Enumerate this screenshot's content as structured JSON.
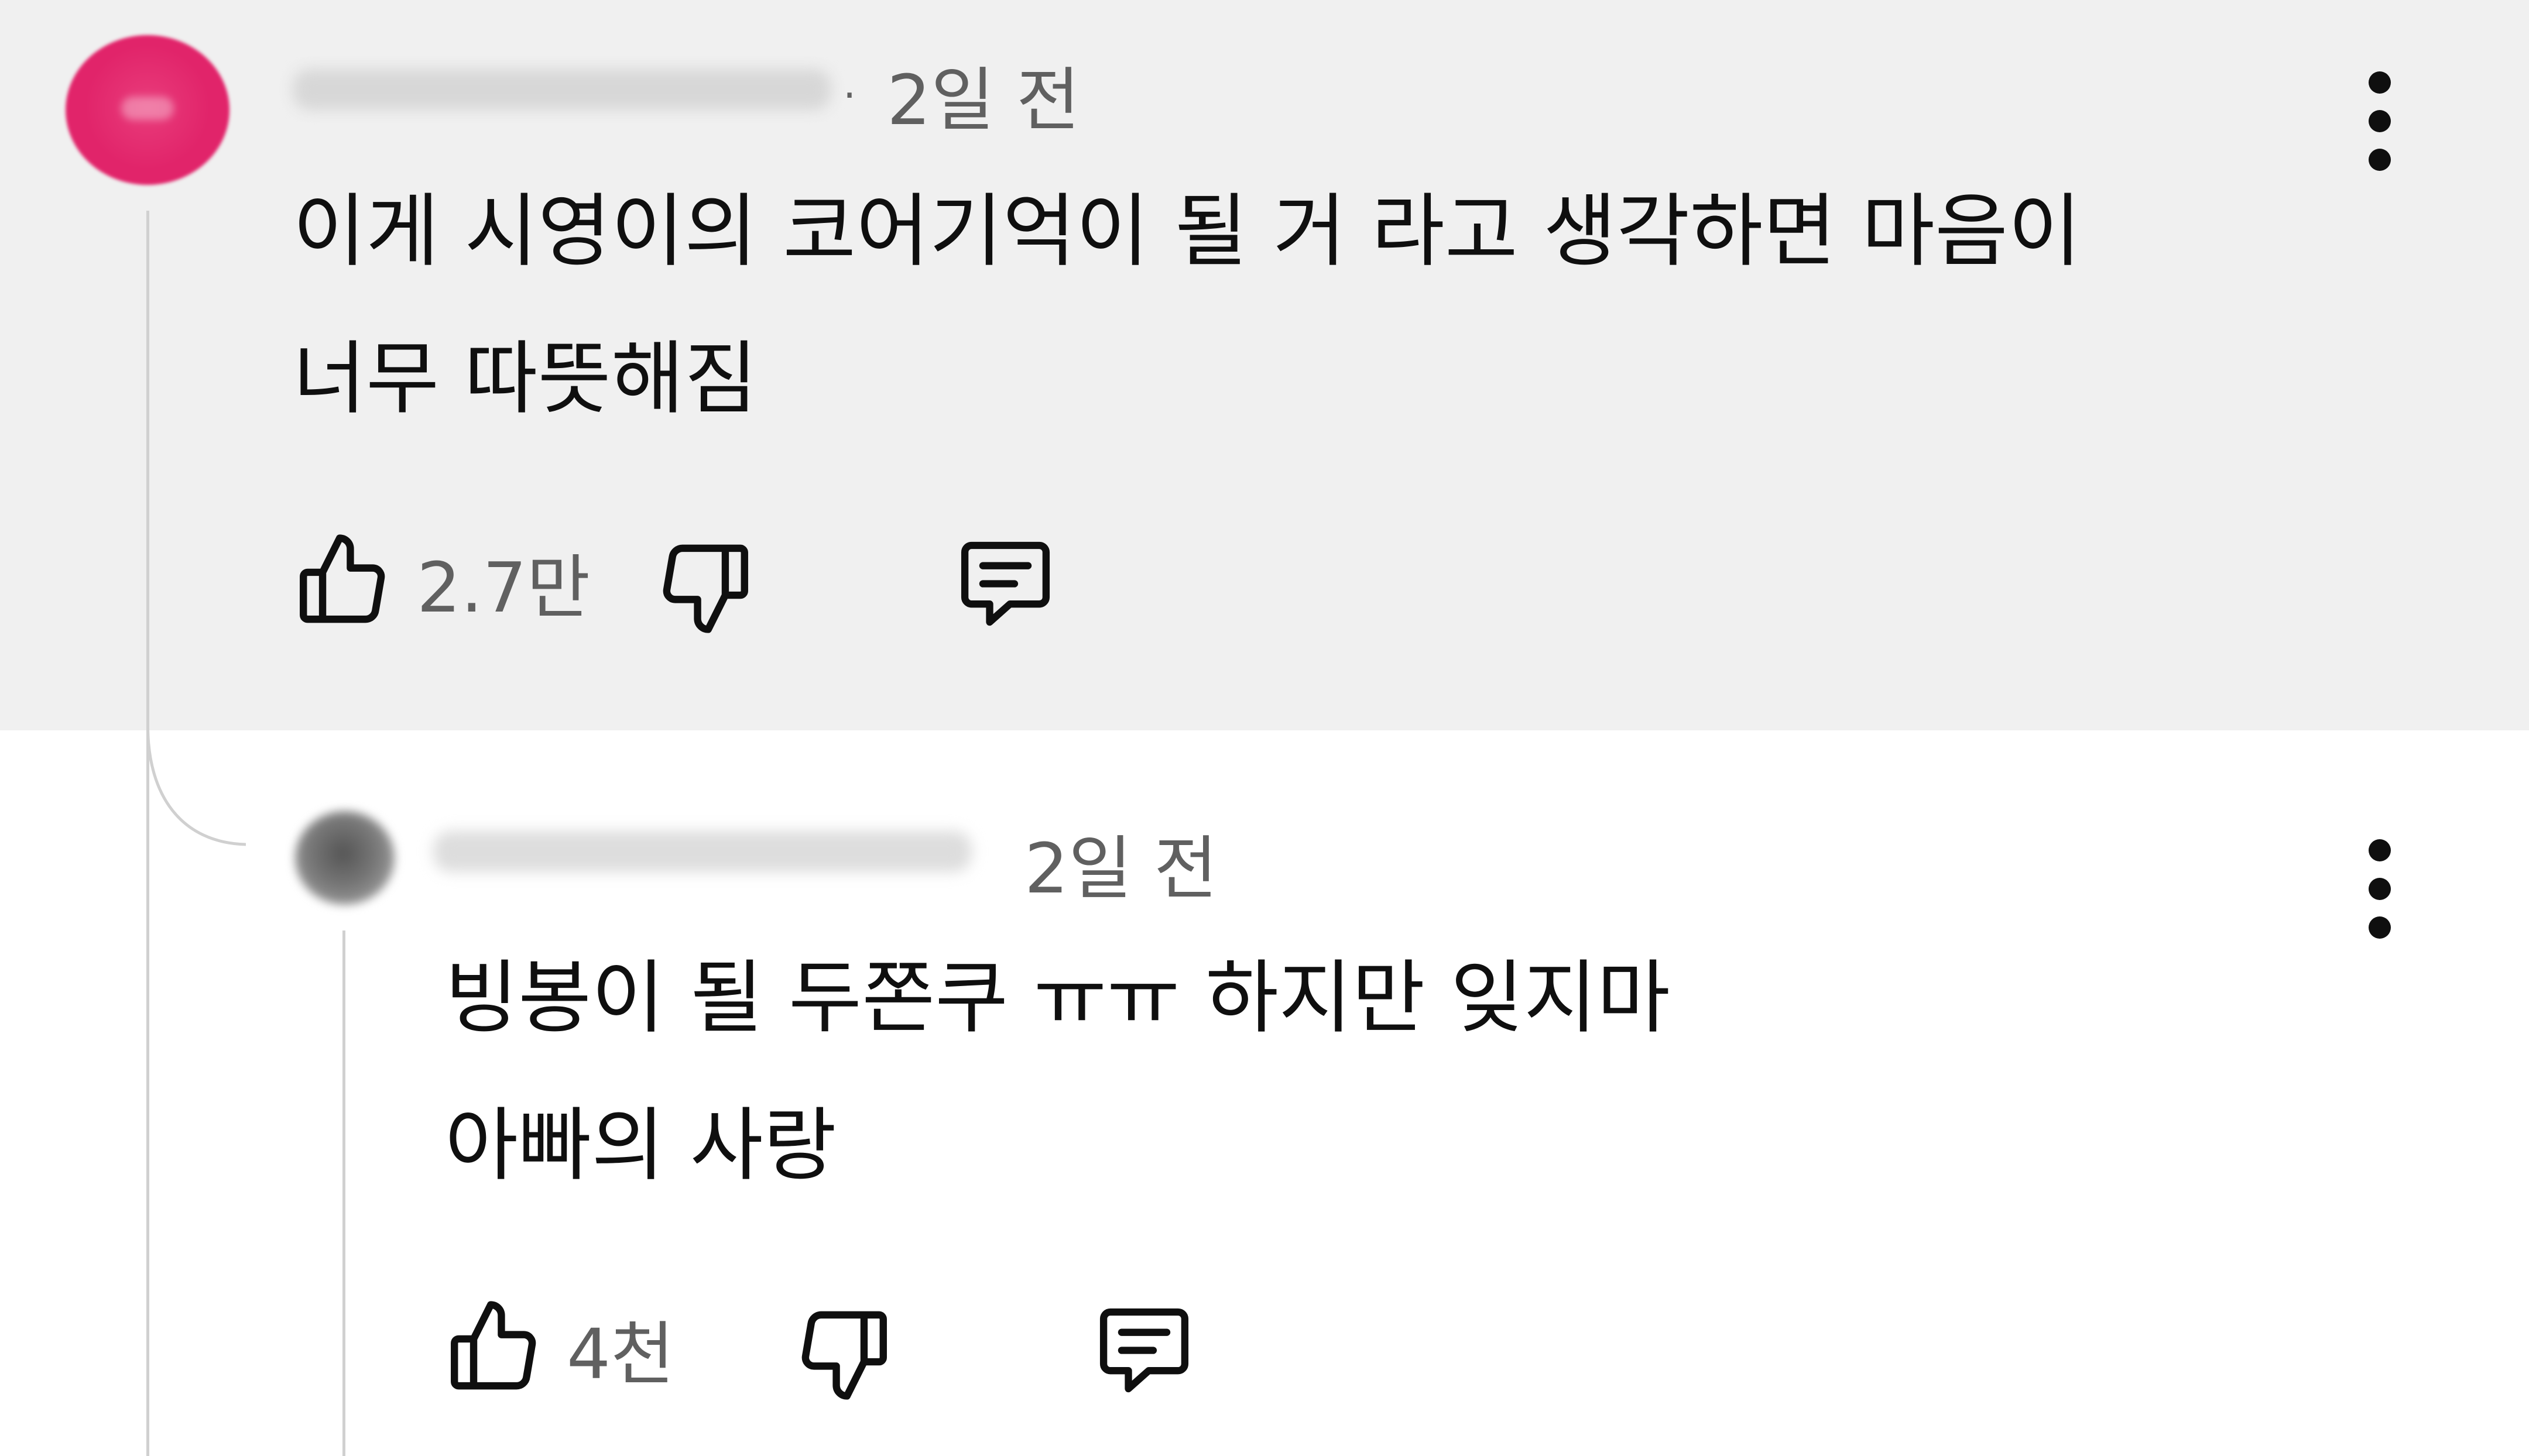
{
  "comments": [
    {
      "time": "2일 전",
      "separator": "·",
      "text": "이게 시영이의 코어기억이 될 거 라고 생각하면 마음이\n너무 따뜻해짐",
      "likes": "2.7만",
      "icons": {
        "like": "thumbs-up-icon",
        "dislike": "thumbs-down-icon",
        "reply": "reply-comment-icon",
        "menu": "more-vert-icon"
      }
    },
    {
      "time": "2일 전",
      "text": "빙봉이 될 두쫀쿠 ㅠㅠ 하지만 잊지마\n아빠의 사랑",
      "likes": "4천",
      "icons": {
        "like": "thumbs-up-icon",
        "dislike": "thumbs-down-icon",
        "reply": "reply-comment-icon",
        "menu": "more-vert-icon"
      }
    }
  ],
  "colors": {
    "highlight_background": "#f0f0f0",
    "avatar_1": "#e1246a",
    "text_primary": "#0f0f0f",
    "text_secondary": "#606060",
    "thread_line": "#d0d0d0"
  }
}
